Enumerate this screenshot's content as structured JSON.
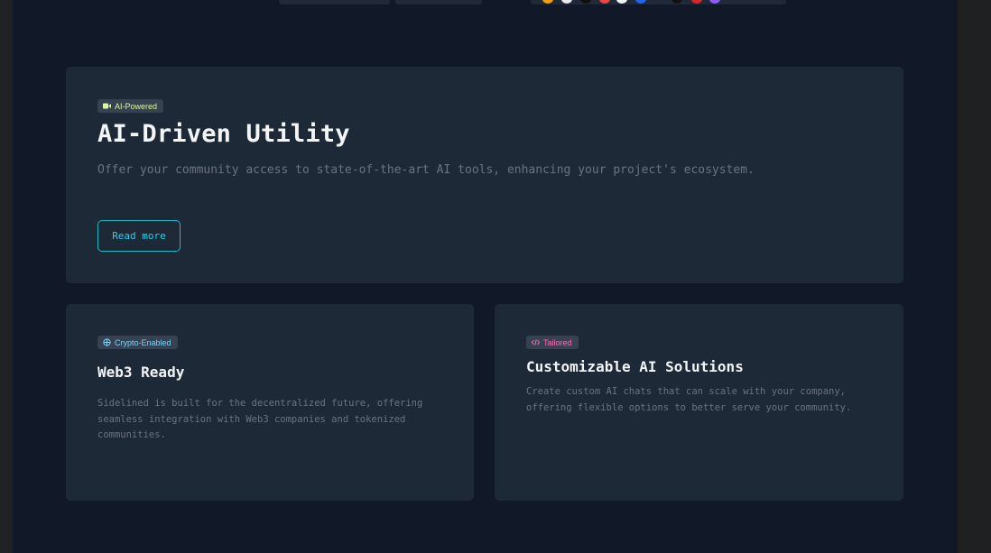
{
  "colors": {
    "page_bg": "#111827",
    "card_bg": "#1e2937",
    "accent_cyan": "#22d3ee",
    "badge_ai": "#d9f99d",
    "badge_crypto": "#7dd3fc",
    "badge_tailored": "#f472b6"
  },
  "top_strip": {
    "dot_colors": [
      "#f59e0b",
      "#e5e7eb",
      "#111111",
      "#ef4444",
      "#f3f4f6",
      "#2563eb",
      "#111111",
      "#dc2626",
      "#8b5cf6"
    ]
  },
  "hero": {
    "badge": {
      "label": "AI-Powered",
      "icon": "video-icon"
    },
    "title": "AI-Driven Utility",
    "description": "Offer your community access to state-of-the-art AI tools, enhancing your project's ecosystem.",
    "button_label": "Read more"
  },
  "cards": [
    {
      "badge": {
        "label": "Crypto-Enabled",
        "icon": "network-icon"
      },
      "title": "Web3 Ready",
      "description": "Sidelined is built for the decentralized future, offering seamless integration with Web3 companies and tokenized communities."
    },
    {
      "badge": {
        "label": "Tailored",
        "icon": "code-icon"
      },
      "title": "Customizable AI Solutions",
      "description": "Create custom AI chats that can scale with your company, offering flexible options to better serve your community."
    }
  ]
}
